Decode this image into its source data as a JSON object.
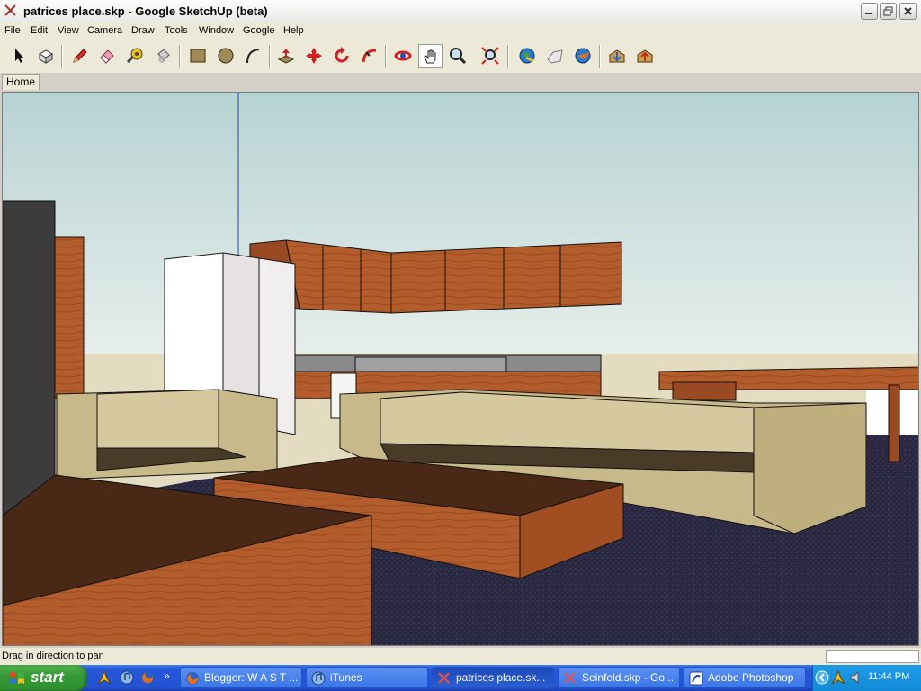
{
  "window": {
    "title": "patrices place.skp - Google SketchUp (beta)"
  },
  "menu": {
    "items": [
      "File",
      "Edit",
      "View",
      "Camera",
      "Draw",
      "Tools",
      "Window",
      "Google",
      "Help"
    ]
  },
  "toolbar": {
    "tools": [
      "select",
      "make-component",
      "pencil",
      "eraser",
      "tape-measure",
      "paint-bucket",
      "rectangle",
      "circle",
      "arc",
      "push-pull",
      "move",
      "rotate",
      "follow-me",
      "orbit",
      "pan",
      "zoom",
      "zoom-extents",
      "get-current-view",
      "toggle-terrain",
      "place-model",
      "get-models",
      "share-model"
    ],
    "active_tool": "pan"
  },
  "scenes": {
    "tabs": [
      "Home"
    ]
  },
  "status": {
    "hint": "Drag in direction to pan",
    "measurements": ""
  },
  "taskbar": {
    "start_label": "start",
    "tasks": [
      "Blogger: W A S T ...",
      "iTunes",
      "patrices place.sk...",
      "Seinfeld.skp - Go...",
      "Adobe Photoshop"
    ],
    "active_task": "patrices place.sk...",
    "clock": "11:44 PM"
  },
  "colors": {
    "sky": "#c8dcdc",
    "ground": "#2a2840",
    "wood": "#b15a2a",
    "sofa": "#c8b98a",
    "taskbar": "#2454d4"
  }
}
